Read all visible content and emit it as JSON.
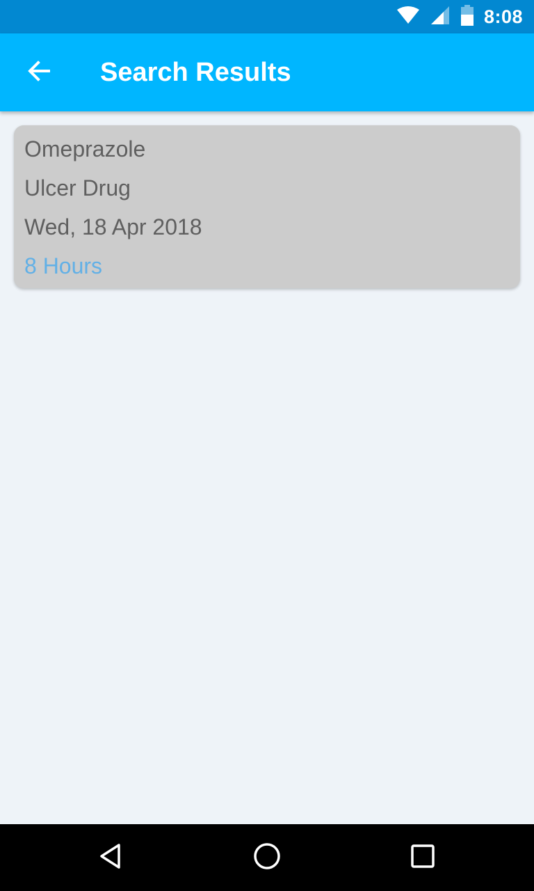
{
  "status_bar": {
    "time": "8:08",
    "icons": [
      "wifi-icon",
      "cell-signal-icon",
      "battery-icon"
    ]
  },
  "app_bar": {
    "title": "Search Results",
    "back_icon": "arrow-left-icon",
    "background_color": "#00b6ff"
  },
  "results": [
    {
      "name": "Omeprazole",
      "type": "Ulcer Drug",
      "date": "Wed, 18 Apr 2018",
      "duration": "8 Hours"
    }
  ],
  "nav_bar": {
    "icons": [
      "triangle-back-icon",
      "circle-home-icon",
      "square-recents-icon"
    ]
  },
  "colors": {
    "status_bar": "#0288d1",
    "card_background": "#cccccc",
    "duration_text": "#62b0e6",
    "page_background": "#eef3f8"
  }
}
